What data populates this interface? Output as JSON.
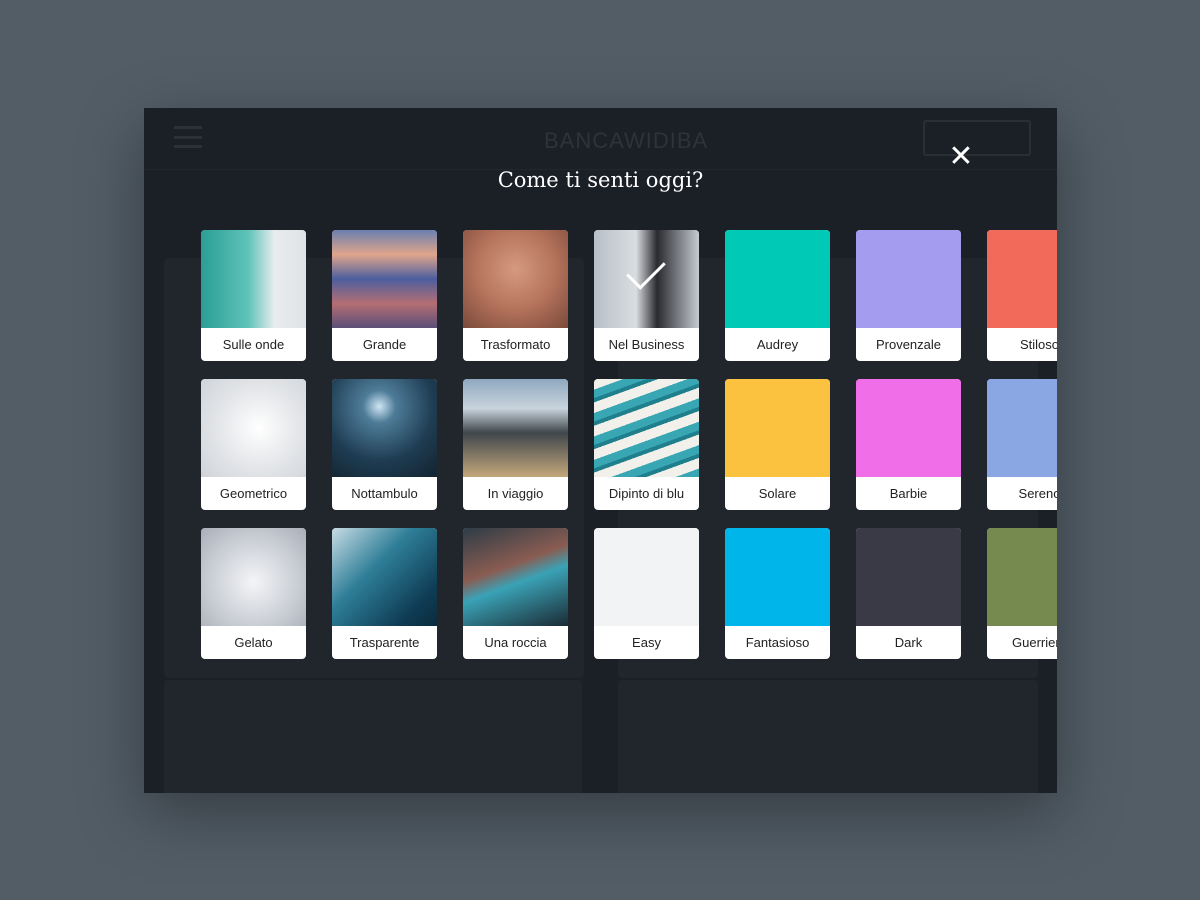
{
  "header": {
    "brand": "BANCAWIDIBA"
  },
  "modal": {
    "title": "Come ti senti oggi?",
    "close_icon": "close-icon"
  },
  "themes": [
    {
      "label": "Sulle onde",
      "bg": "linear-gradient(90deg,#2a9e96 0%,#5fc3b8 45%,#e8ecee 70%,#dfe3e5 100%)"
    },
    {
      "label": "Grande",
      "bg": "linear-gradient(180deg,#6a7fae 0%,#e0a58c 25%,#4c5e9e 50%,#b46e74 75%,#5a4f77 100%)"
    },
    {
      "label": "Trasformato",
      "bg": "radial-gradient(circle at 50% 40%,#d69a80 0%,#b5735c 50%,#7a4a3a 100%)"
    },
    {
      "label": "Nel Business",
      "bg": "linear-gradient(90deg,#b7c0c8 0%,#d9dde0 40%,#2a2a30 60%,#c5cbd0 100%)",
      "selected": true
    },
    {
      "label": "Audrey",
      "bg": "#00c9b5"
    },
    {
      "label": "Provenzale",
      "bg": "#a39cef"
    },
    {
      "label": "Stiloso",
      "bg": "#f26a5a"
    },
    {
      "label": "Geometrico",
      "bg": "radial-gradient(circle at 55% 50%,#ffffff 0%,#e5e7ea 50%,#cfd3d8 100%)"
    },
    {
      "label": "Nottambulo",
      "bg": "radial-gradient(circle at 45% 28%,#cfe6f5 0%,#4e7c98 18%,#1e3c52 60%,#13232f 100%)"
    },
    {
      "label": "In viaggio",
      "bg": "linear-gradient(180deg,#8fa8c0 0%,#c9d4dc 30%,#3f464c 55%,#c4a77a 100%)"
    },
    {
      "label": "Dipinto di blu",
      "bg": "repeating-linear-gradient(160deg,#f2f0ea 0 10px,#38a7b3 10px 18px,#1f7f8d 18px 22px)"
    },
    {
      "label": "Solare",
      "bg": "#fbc240"
    },
    {
      "label": "Barbie",
      "bg": "#f06ee8"
    },
    {
      "label": "Sereno",
      "bg": "#8aa6e3"
    },
    {
      "label": "Gelato",
      "bg": "radial-gradient(circle at 50% 55%,#f4f5f7 0%,#c8ccd3 60%,#a8aeb8 100%)"
    },
    {
      "label": "Trasparente",
      "bg": "linear-gradient(135deg,#c8dce4 0%,#2f7e98 40%,#0f3d55 80%,#0a2a3c 100%)"
    },
    {
      "label": "Una roccia",
      "bg": "linear-gradient(160deg,#2d3c46 0%,#8a5c52 40%,#3aa2b6 55%,#1b2a33 100%)"
    },
    {
      "label": "Easy",
      "bg": "#f2f3f5"
    },
    {
      "label": "Fantasioso",
      "bg": "#00b5ea"
    },
    {
      "label": "Dark",
      "bg": "#393a45"
    },
    {
      "label": "Guerriero",
      "bg": "#76894f"
    }
  ]
}
